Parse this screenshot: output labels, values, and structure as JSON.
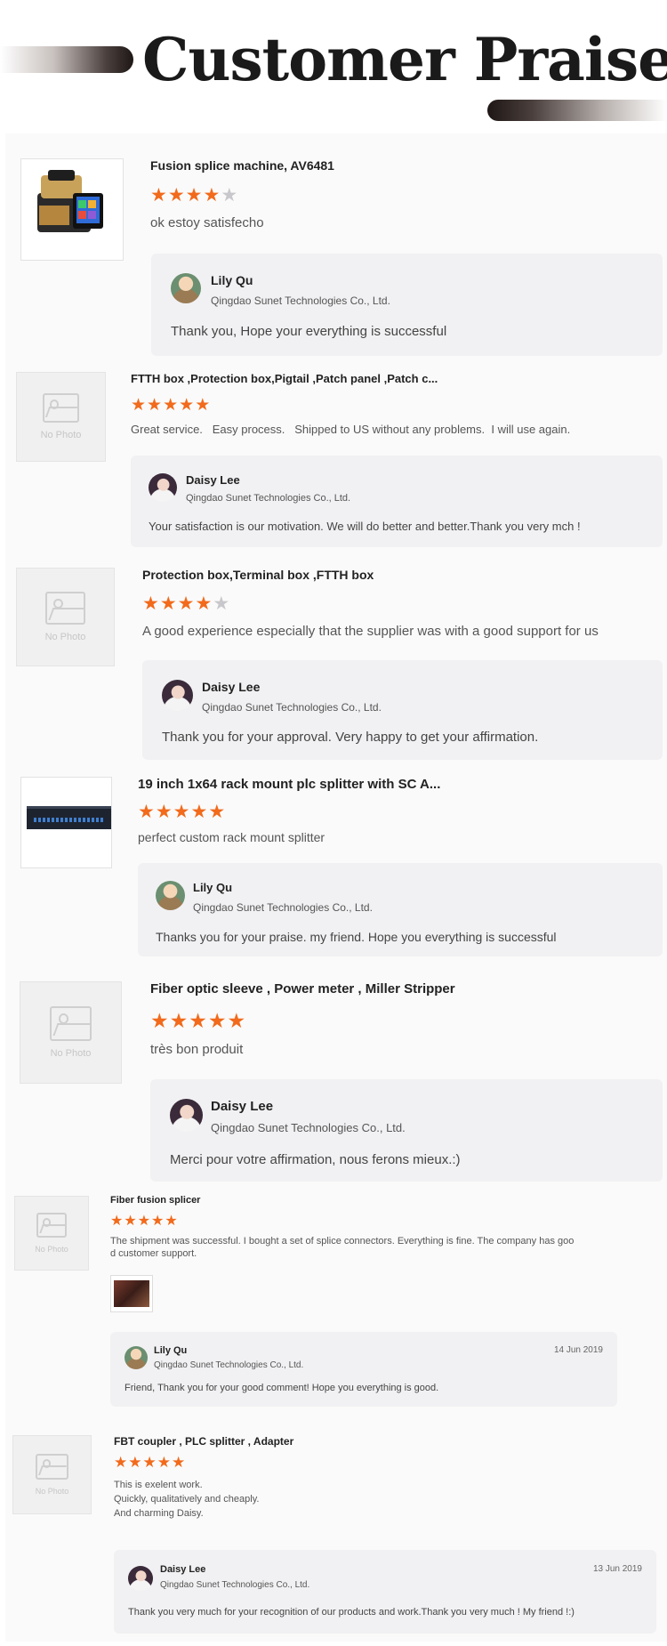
{
  "banner": {
    "title": "Customer Praise"
  },
  "no_photo_label": "No Photo",
  "reviews": [
    {
      "product": "Fusion splice machine, AV6481",
      "stars": 4,
      "comment": "ok estoy satisfecho",
      "reply": {
        "name": "Lily Qu",
        "company": "Qingdao Sunet Technologies Co., Ltd.",
        "text": "Thank you, Hope your everything is successful",
        "date": ""
      }
    },
    {
      "product": "FTTH box ,Protection box,Pigtail ,Patch panel ,Patch c...",
      "stars": 5,
      "comment": "Great service.   Easy process.   Shipped to US without any problems.  I will use again.",
      "reply": {
        "name": "Daisy Lee",
        "company": "Qingdao Sunet Technologies Co., Ltd.",
        "text": "Your satisfaction is our motivation. We will do better and better.Thank you very mch !",
        "date": ""
      }
    },
    {
      "product": "Protection box,Terminal box ,FTTH box",
      "stars": 4,
      "comment": "A good experience especially that the supplier was with a good support for us",
      "reply": {
        "name": "Daisy Lee",
        "company": "Qingdao Sunet Technologies Co., Ltd.",
        "text": "Thank you for your approval. Very happy to get your affirmation.",
        "date": ""
      }
    },
    {
      "product": "19 inch 1x64 rack mount plc splitter with SC A...",
      "stars": 5,
      "comment": "perfect custom rack mount splitter",
      "reply": {
        "name": "Lily Qu",
        "company": "Qingdao Sunet Technologies Co., Ltd.",
        "text": "Thanks you for your praise. my friend. Hope you everything is successful",
        "date": ""
      }
    },
    {
      "product": "Fiber optic sleeve , Power meter , Miller Stripper",
      "stars": 5,
      "comment": "très bon produit",
      "reply": {
        "name": "Daisy Lee",
        "company": "Qingdao Sunet Technologies Co., Ltd.",
        "text": "Merci pour votre affirmation, nous ferons mieux.:)",
        "date": ""
      }
    },
    {
      "product": "Fiber fusion splicer",
      "stars": 5,
      "comment": "The shipment was successful. I bought a set of splice connectors. Everything is fine. The company has goo",
      "comment2": "d customer support.",
      "reply": {
        "name": "Lily Qu",
        "company": "Qingdao Sunet Technologies Co., Ltd.",
        "text": "Friend, Thank you for your good comment! Hope you everything is good.",
        "date": "14 Jun 2019"
      }
    },
    {
      "product": "FBT coupler , PLC splitter , Adapter",
      "stars": 5,
      "comment": "This is exelent work.",
      "comment2": "Quickly, qualitatively and cheaply.",
      "comment3": "And charming Daisy.",
      "reply": {
        "name": "Daisy Lee",
        "company": "Qingdao Sunet Technologies Co., Ltd.",
        "text": "Thank you very much for your recognition of our products and work.Thank you very much ! My friend !:)",
        "date": "13 Jun 2019"
      }
    }
  ],
  "colors": {
    "star_on": "#f26a1b",
    "star_off": "#c8c8cc",
    "reply_bg": "#f1f1f3"
  },
  "icons": {
    "star": "star-icon",
    "no_photo": "image-placeholder-icon"
  }
}
